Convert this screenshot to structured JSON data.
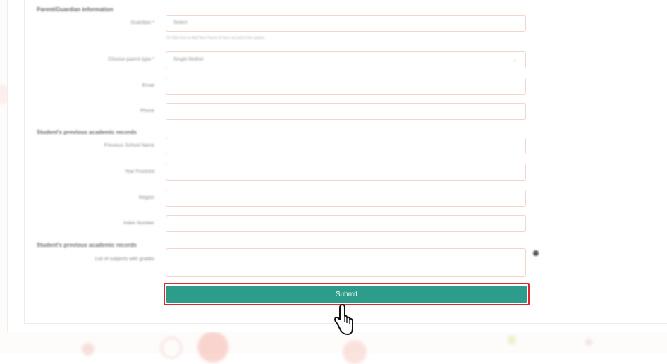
{
  "sections": {
    "parent_guardian": "Parent/Guardian information",
    "previous_school": "Student's previous academic records",
    "previous_subjects": "Student's previous academic records"
  },
  "fields": {
    "guardian": {
      "label": "Guardian *",
      "value": "Select",
      "hint": "Or Click here to Add New Parent (if have not yet) to the system"
    },
    "parent_type": {
      "label": "Choose parent type *",
      "value": "Single Mother"
    },
    "email": {
      "label": "Email",
      "value": ""
    },
    "phone": {
      "label": "Phone",
      "value": ""
    },
    "previous_school_name": {
      "label": "Previous School Name",
      "value": ""
    },
    "year_finished": {
      "label": "Year Finished",
      "value": ""
    },
    "region": {
      "label": "Region",
      "value": ""
    },
    "index_number": {
      "label": "Index Number",
      "value": ""
    },
    "subjects": {
      "label": "List of subjects with grades",
      "value": ""
    }
  },
  "submit_label": "Submit",
  "colors": {
    "submit_bg": "#2e9c8a",
    "highlight_border": "#e0262e",
    "input_border": "#f0d6cc"
  },
  "icons": {
    "help": "help-icon",
    "cursor": "hand-pointer-icon",
    "dropdown": "chevron-down-icon"
  }
}
